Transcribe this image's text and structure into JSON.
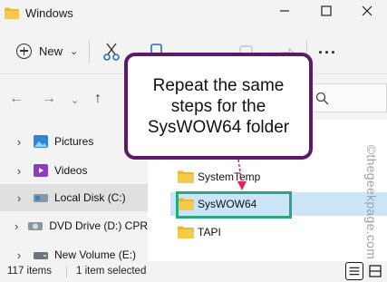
{
  "window": {
    "title": "Windows",
    "folder_color": "#e8b830"
  },
  "window_controls": [
    "minimize",
    "maximize",
    "close"
  ],
  "toolbar": {
    "new_label": "New",
    "icons": [
      "cut-icon",
      "copy-icon",
      "paste-icon",
      "rename-icon",
      "share-icon",
      "delete-icon",
      "more-icon"
    ]
  },
  "navigation": [
    "back",
    "forward",
    "up"
  ],
  "sidebar": {
    "items": [
      {
        "label": "Pictures",
        "icon": "pictures-icon"
      },
      {
        "label": "Videos",
        "icon": "videos-icon"
      },
      {
        "label": "Local Disk (C:)",
        "icon": "local-disk-icon",
        "selected": true
      },
      {
        "label": "DVD Drive (D:) CPR",
        "icon": "dvd-drive-icon"
      },
      {
        "label": "New Volume (E:)",
        "icon": "drive-icon"
      }
    ]
  },
  "files": [
    {
      "name": "SystemTemp"
    },
    {
      "name": "SysWOW64",
      "selected": true
    },
    {
      "name": "TAPI"
    }
  ],
  "status": {
    "item_count": "117 items",
    "selection": "1 item selected"
  },
  "callout": {
    "text": "Repeat the same steps for the SysWOW64 folder",
    "border_color": "#5b1a66"
  },
  "highlight_color": "#27a880",
  "arrow_color": "#e0245e",
  "watermark": "©thegeekpage.com",
  "selection_color": "#cce4f7"
}
